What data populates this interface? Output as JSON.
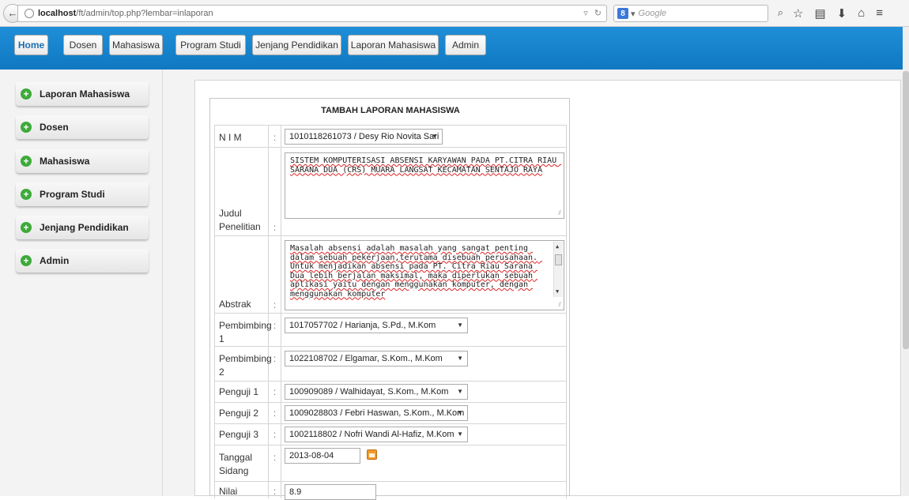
{
  "browser": {
    "url_host": "localhost",
    "url_path": "/ft/admin/top.php?lembar=inlaporan",
    "search_placeholder": "Google",
    "search_engine_glyph": "8"
  },
  "nav": {
    "items": [
      "Home",
      "Dosen",
      "Mahasiswa",
      "Program Studi",
      "Jenjang Pendidikan",
      "Laporan Mahasiswa",
      "Admin"
    ],
    "active": "Home",
    "accent_color": "#1584d0"
  },
  "sidebar": {
    "items": [
      "Laporan Mahasiswa",
      "Dosen",
      "Mahasiswa",
      "Program Studi",
      "Jenjang Pendidikan",
      "Admin"
    ]
  },
  "form": {
    "title": "TAMBAH LAPORAN MAHASISWA",
    "fields": {
      "nim": {
        "label": "N I M",
        "value": "1010118261073 / Desy Rio Novita Sari"
      },
      "judul": {
        "label": "Judul Penelitian",
        "value": "SISTEM KOMPUTERISASI ABSENSI KARYAWAN PADA PT.CITRA RIAU SARANA DUA (CRS) MUARA LANGSAT KECAMATAN SENTAJO RAYA"
      },
      "abstrak": {
        "label": "Abstrak",
        "value": "Masalah absensi adalah masalah yang sangat penting dalam sebuah pekerjaan,terutama disebuah perusahaan. Untuk menjadikan absensi pada PT. Citra Riau Sarana Dua lebih berjalan maksimal, maka diperlukan sebuah aplikasi yaitu dengan menggunakan komputer, dengan menggunakan komputer"
      },
      "pembimbing1": {
        "label": "Pembimbing 1",
        "value": "1017057702 / Harianja, S.Pd., M.Kom"
      },
      "pembimbing2": {
        "label": "Pembimbing 2",
        "value": "1022108702 / Elgamar, S.Kom., M.Kom"
      },
      "penguji1": {
        "label": "Penguji 1",
        "value": "100909089 / Walhidayat, S.Kom., M.Kom"
      },
      "penguji2": {
        "label": "Penguji 2",
        "value": "1009028803 / Febri Haswan, S.Kom., M.Kom"
      },
      "penguji3": {
        "label": "Penguji 3",
        "value": "1002118802 / Nofri Wandi Al-Hafiz, M.Kom"
      },
      "tanggal": {
        "label": "Tanggal Sidang",
        "value": "2013-08-04"
      },
      "nilai": {
        "label": "Nilai",
        "value": "8.9"
      }
    },
    "separator": ":"
  },
  "icons": {
    "back": "back-arrow-icon",
    "globe": "globe-icon",
    "sidebar_bullet": "plus-circle-icon",
    "calendar": "calendar-icon"
  }
}
